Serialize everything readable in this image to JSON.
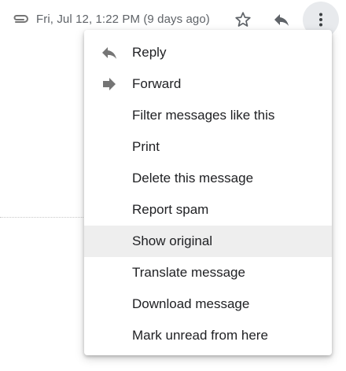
{
  "header": {
    "attachment_icon": "paperclip-icon",
    "date": "Fri, Jul 12, 1:22 PM (9 days ago)",
    "star_icon": "star-outline-icon",
    "reply_icon": "reply-icon",
    "more_icon": "more-vertical-icon"
  },
  "menu": {
    "items": [
      {
        "label": "Reply",
        "icon": "reply-icon"
      },
      {
        "label": "Forward",
        "icon": "forward-icon"
      },
      {
        "label": "Filter messages like this"
      },
      {
        "label": "Print"
      },
      {
        "label": "Delete this message"
      },
      {
        "label": "Report spam"
      },
      {
        "label": "Show original",
        "highlighted": true
      },
      {
        "label": "Translate message"
      },
      {
        "label": "Download message"
      },
      {
        "label": "Mark unread from here"
      }
    ]
  },
  "colors": {
    "text_primary": "#202124",
    "text_secondary": "#5f6368",
    "icon_gray": "#757575",
    "hover_bg": "#eeeeee",
    "active_button_bg": "#e8eaed"
  }
}
